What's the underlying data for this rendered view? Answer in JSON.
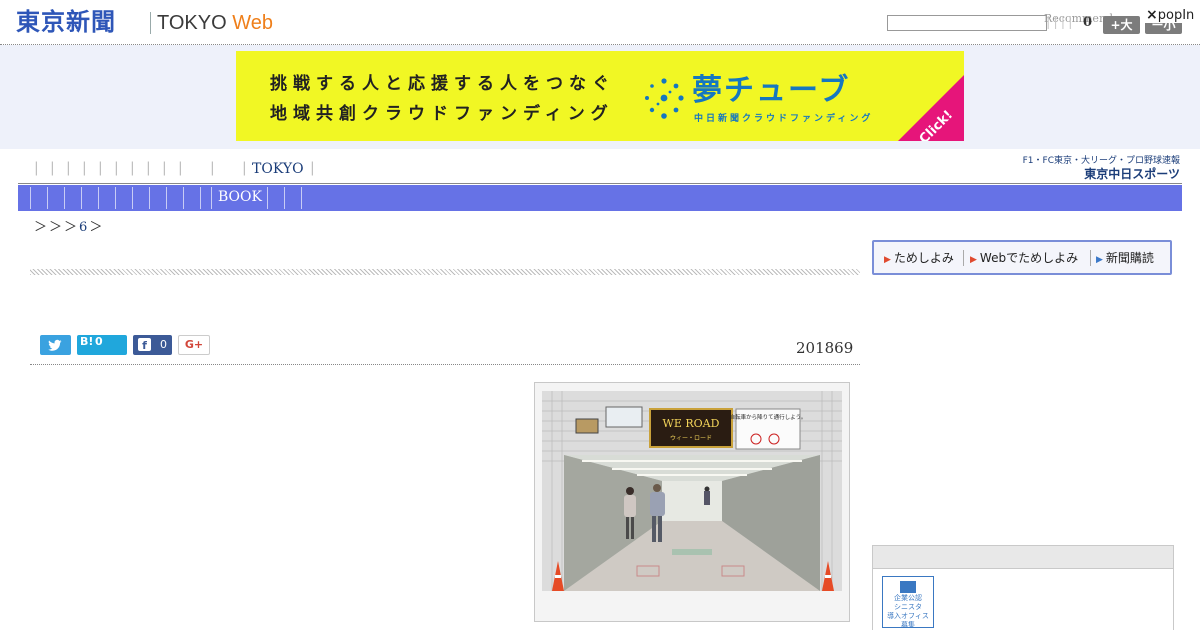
{
  "header": {
    "logo_jp": "東京新聞",
    "logo_en_prefix": "TOKYO",
    "logo_en_suffix": "Web",
    "search_placeholder": "",
    "recommend_label": "Recommend",
    "count": "0",
    "font_bigger": "+大",
    "font_smaller": "ー小",
    "popin_close": "×",
    "popin_label": "popIn"
  },
  "banner": {
    "line1": "挑戦する人と応援する人をつなぐ",
    "line2": "地域共創クラウドファンディング",
    "brand": "夢チューブ",
    "sub": "中日新聞クラウドファンディング",
    "click": "Click!",
    "bg_color": "#f1f724",
    "brand_color": "#1577c0",
    "click_color": "#e6157a"
  },
  "nav": {
    "row1_pipes": "|",
    "tokyo_label": "TOKYO",
    "book_label": "BOOK",
    "bar_color": "#6672e6",
    "sports_top": "F1・FC東京・大リーグ・プロ野球速報",
    "sports_bottom": "東京中日スポーツ"
  },
  "breadcrumb": {
    "sep1": "＞",
    "sep2": "＞",
    "sep3": "＞",
    "page": "6",
    "sep4": "＞"
  },
  "subscribe": {
    "item1": "ためしよみ",
    "item2": "Webでためしよみ",
    "item3": "新聞購読"
  },
  "article": {
    "date": "201869",
    "photo_sign": "WE ROAD",
    "photo_sign_sub": "ウィー・ロード",
    "photo_notice": "自転車から降りて通行しよう。"
  },
  "share": {
    "twitter_icon": "twitter-bird-icon",
    "hatena_label": "B!",
    "hatena_count": "0",
    "facebook_label": "f",
    "facebook_count": "0",
    "gplus_label": "G+"
  },
  "sidebar": {
    "badge_line1": "企業公認",
    "badge_line2": "シニスタ",
    "badge_line3": "導入オフィス",
    "badge_line4": "募集"
  }
}
